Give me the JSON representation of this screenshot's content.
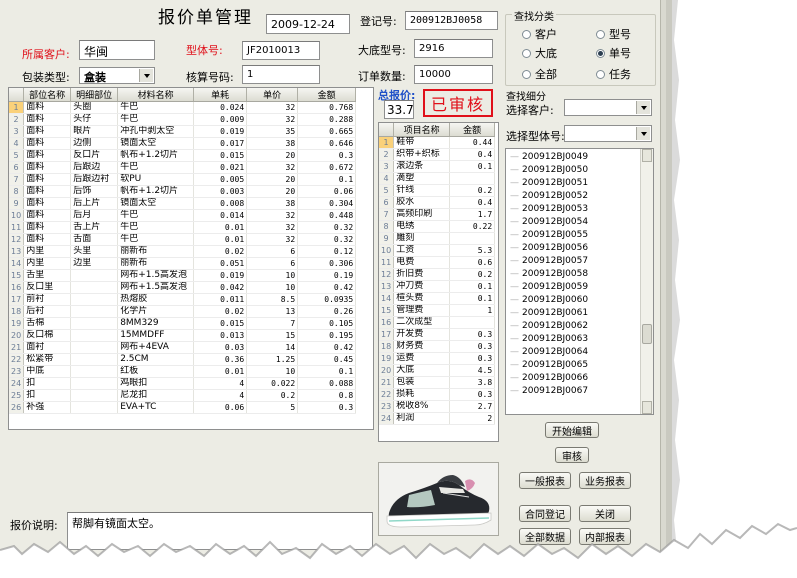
{
  "header": {
    "title": "报价单管理",
    "date": "2009-12-24",
    "reg_label": "登记号:",
    "reg_value": "200912BJ0058"
  },
  "form": {
    "customer_label": "所属客户:",
    "customer_value": "华闽",
    "model_label": "型体号:",
    "model_value": "JF2010013",
    "base_model_label": "大底型号:",
    "base_model_value": "2916",
    "pack_label": "包装类型:",
    "pack_value": "盒装",
    "account_label": "核算号码:",
    "account_value": "1",
    "order_label": "订单数量:",
    "order_value": "10000",
    "total_label": "总报价:",
    "total_value": "33.7",
    "stamp": "已审核",
    "note_label": "报价说明:",
    "note_value": "帮脚有镜面太空。"
  },
  "filter": {
    "title": "查找分类",
    "options": [
      {
        "label": "客户",
        "checked": false
      },
      {
        "label": "型号",
        "checked": false
      },
      {
        "label": "大底",
        "checked": false
      },
      {
        "label": "单号",
        "checked": true
      },
      {
        "label": "全部",
        "checked": false
      },
      {
        "label": "任务",
        "checked": false
      }
    ],
    "detail_title": "查找细分",
    "choose_customer_label": "选择客户:",
    "choose_model_label": "选择型体号:"
  },
  "materials": {
    "columns": [
      "部位名称",
      "明细部位",
      "材料名称",
      "单耗",
      "单价",
      "金额"
    ],
    "rows": [
      [
        "1",
        "面料",
        "头圈",
        "牛巴",
        "0.024",
        "32",
        "0.768"
      ],
      [
        "2",
        "面料",
        "头仔",
        "牛巴",
        "0.009",
        "32",
        "0.288"
      ],
      [
        "3",
        "面料",
        "眼片",
        "冲孔中剥太空",
        "0.019",
        "35",
        "0.665"
      ],
      [
        "4",
        "面料",
        "边侧",
        "镜面太空",
        "0.017",
        "38",
        "0.646"
      ],
      [
        "5",
        "面料",
        "反口片",
        "帆布+1.2切片",
        "0.015",
        "20",
        "0.3"
      ],
      [
        "6",
        "面料",
        "后跟边",
        "牛巴",
        "0.021",
        "32",
        "0.672"
      ],
      [
        "7",
        "面料",
        "后跟边衬",
        "软PU",
        "0.005",
        "20",
        "0.1"
      ],
      [
        "8",
        "面料",
        "后饰",
        "帆布+1.2切片",
        "0.003",
        "20",
        "0.06"
      ],
      [
        "9",
        "面料",
        "后上片",
        "镜面太空",
        "0.008",
        "38",
        "0.304"
      ],
      [
        "10",
        "面料",
        "后月",
        "牛巴",
        "0.014",
        "32",
        "0.448"
      ],
      [
        "11",
        "面料",
        "舌上片",
        "牛巴",
        "0.01",
        "32",
        "0.32"
      ],
      [
        "12",
        "面料",
        "舌面",
        "牛巴",
        "0.01",
        "32",
        "0.32"
      ],
      [
        "13",
        "内里",
        "头里",
        "丽新布",
        "0.02",
        "6",
        "0.12"
      ],
      [
        "14",
        "内里",
        "边里",
        "丽新布",
        "0.051",
        "6",
        "0.306"
      ],
      [
        "15",
        "舌里",
        "",
        "网布+1.5高发泡",
        "0.019",
        "10",
        "0.19"
      ],
      [
        "16",
        "反口里",
        "",
        "网布+1.5高发泡",
        "0.042",
        "10",
        "0.42"
      ],
      [
        "17",
        "前衬",
        "",
        "热熔胶",
        "0.011",
        "8.5",
        "0.0935"
      ],
      [
        "18",
        "后衬",
        "",
        "化学片",
        "0.02",
        "13",
        "0.26"
      ],
      [
        "19",
        "舌棉",
        "",
        "8MM329",
        "0.015",
        "7",
        "0.105"
      ],
      [
        "20",
        "反口棉",
        "",
        "15MMDFF",
        "0.013",
        "15",
        "0.195"
      ],
      [
        "21",
        "面衬",
        "",
        "网布+4EVA",
        "0.03",
        "14",
        "0.42"
      ],
      [
        "22",
        "松紧带",
        "",
        "2.5CM",
        "0.36",
        "1.25",
        "0.45"
      ],
      [
        "23",
        "中底",
        "",
        "红板",
        "0.01",
        "10",
        "0.1"
      ],
      [
        "24",
        "扣",
        "",
        "鸡眼扣",
        "4",
        "0.022",
        "0.088"
      ],
      [
        "25",
        "扣",
        "",
        "尼龙扣",
        "4",
        "0.2",
        "0.8"
      ],
      [
        "26",
        "补强",
        "",
        "EVA+TC",
        "0.06",
        "5",
        "0.3"
      ]
    ]
  },
  "costs": {
    "columns": [
      "项目名称",
      "金额"
    ],
    "rows": [
      [
        "1",
        "鞋带",
        "0.44"
      ],
      [
        "2",
        "织带+织标",
        "0.4"
      ],
      [
        "3",
        "滚边条",
        "0.1"
      ],
      [
        "4",
        "滴塑",
        ""
      ],
      [
        "5",
        "针线",
        "0.2"
      ],
      [
        "6",
        "胶水",
        "0.4"
      ],
      [
        "7",
        "高频印刷",
        "1.7"
      ],
      [
        "8",
        "电绣",
        "0.22"
      ],
      [
        "9",
        "雕刻",
        ""
      ],
      [
        "10",
        "工资",
        "5.3"
      ],
      [
        "11",
        "电费",
        "0.6"
      ],
      [
        "12",
        "折旧费",
        "0.2"
      ],
      [
        "13",
        "冲刀费",
        "0.1"
      ],
      [
        "14",
        "楦头费",
        "0.1"
      ],
      [
        "15",
        "管理费",
        "1"
      ],
      [
        "16",
        "二次成型",
        ""
      ],
      [
        "17",
        "开发费",
        "0.3"
      ],
      [
        "18",
        "财务费",
        "0.3"
      ],
      [
        "19",
        "运费",
        "0.3"
      ],
      [
        "20",
        "大底",
        "4.5"
      ],
      [
        "21",
        "包装",
        "3.8"
      ],
      [
        "22",
        "损耗",
        "0.3"
      ],
      [
        "23",
        "税收8%",
        "2.7"
      ],
      [
        "24",
        "利润",
        "2"
      ]
    ]
  },
  "codes": [
    "200912BJ0049",
    "200912BJ0050",
    "200912BJ0051",
    "200912BJ0052",
    "200912BJ0053",
    "200912BJ0054",
    "200912BJ0055",
    "200912BJ0056",
    "200912BJ0057",
    "200912BJ0058",
    "200912BJ0059",
    "200912BJ0060",
    "200912BJ0061",
    "200912BJ0062",
    "200912BJ0063",
    "200912BJ0064",
    "200912BJ0065",
    "200912BJ0066",
    "200912BJ0067"
  ],
  "buttons": {
    "start_edit": "开始编辑",
    "audit": "审核",
    "general_report": "一般报表",
    "business_report": "业务报表",
    "contract_register": "合同登记",
    "close": "关闭",
    "all_data": "全部数据",
    "internal_report": "内部报表"
  },
  "colors": {
    "red_label": "#e0101a",
    "window_bg": "#ecece4",
    "selected_row": "#fad17a"
  }
}
